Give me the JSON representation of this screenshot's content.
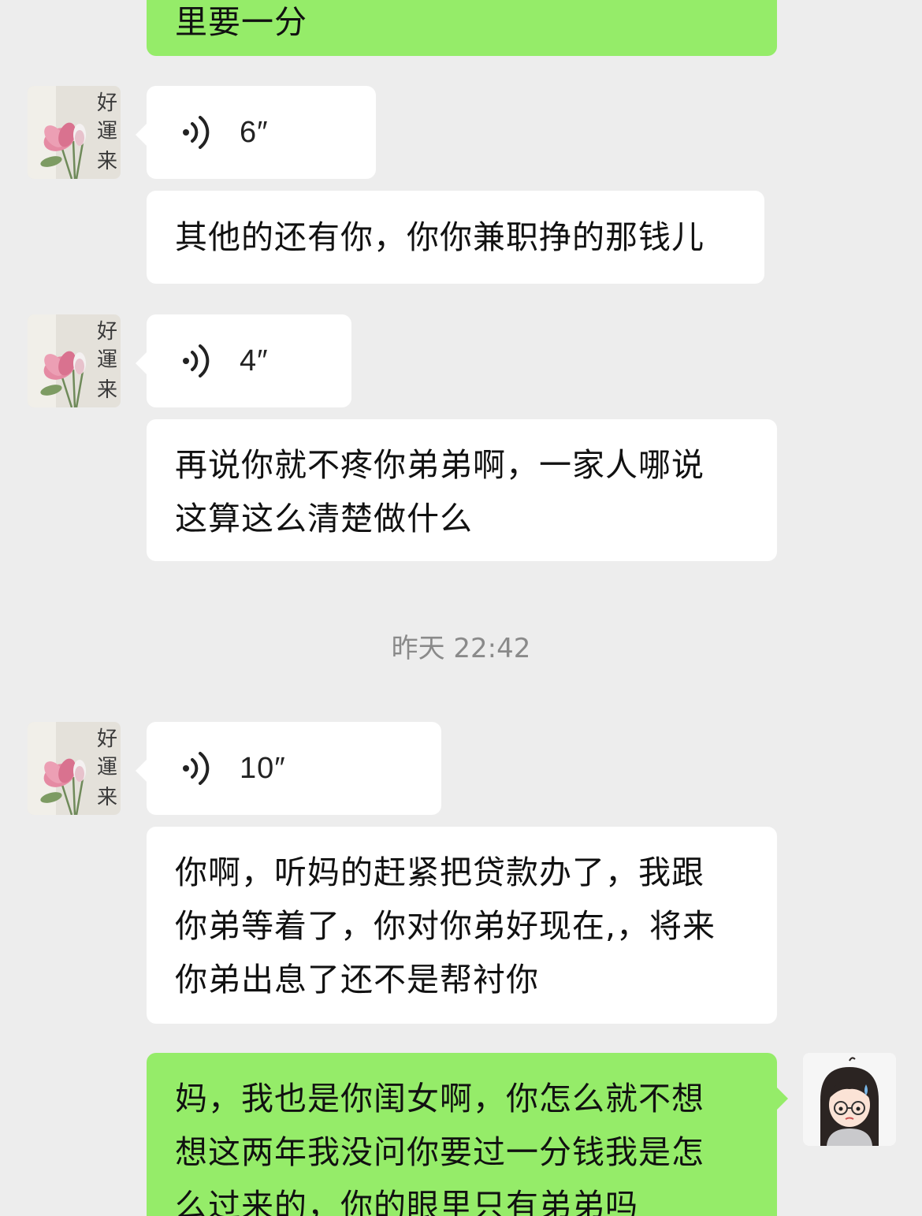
{
  "messages": {
    "m0": {
      "text": "里要一分"
    },
    "m1": {
      "duration": "6″"
    },
    "m2": {
      "text": "其他的还有你，你你兼职挣的那钱儿"
    },
    "m3": {
      "duration": "4″"
    },
    "m4": {
      "line1": "再说你就不疼你弟弟啊，一家人哪说",
      "line2": "这算这么清楚做什么"
    },
    "m5": {
      "duration": "10″"
    },
    "m6": {
      "line1": "你啊，听妈的赶紧把贷款办了，我跟",
      "line2": "你弟等着了，你对你弟好现在,，将来",
      "line3": "你弟出息了还不是帮衬你"
    },
    "m7": {
      "line1": "妈，我也是你闺女啊，你怎么就不想",
      "line2": "想这两年我没问你要过一分钱我是怎",
      "line3": "么过来的，你的眼里只有弟弟吗"
    }
  },
  "timestamp": "昨天 22:42",
  "avatars": {
    "mom_calligraphy": [
      "好",
      "運",
      "来"
    ]
  },
  "colors": {
    "background": "#ededed",
    "incoming_bubble": "#ffffff",
    "outgoing_bubble": "#95ec69",
    "timestamp_text": "#8a8a8a"
  }
}
